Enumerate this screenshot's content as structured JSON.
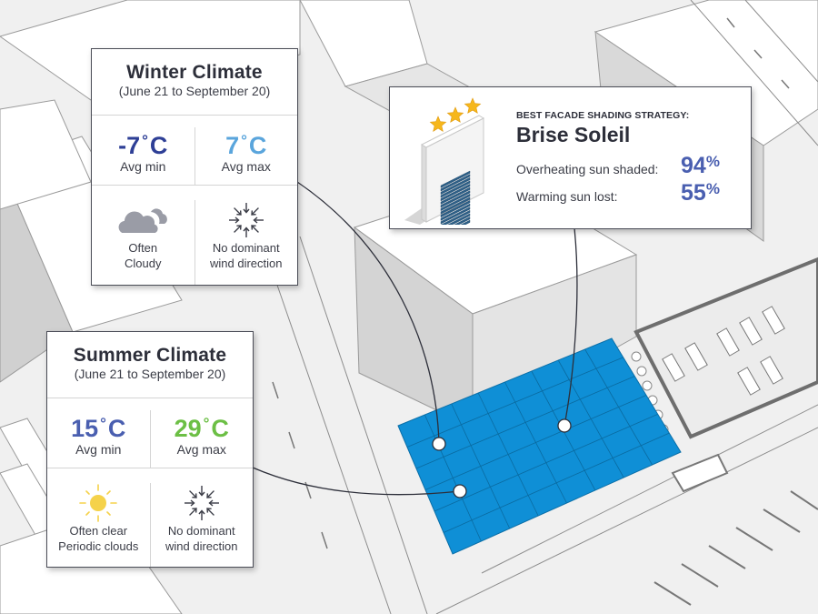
{
  "winter": {
    "title": "Winter Climate",
    "period": "(June 21 to September 20)",
    "avg_min": {
      "value": "-7",
      "unit": "C",
      "label": "Avg min",
      "color": "#2e3f96"
    },
    "avg_max": {
      "value": "7",
      "unit": "C",
      "label": "Avg max",
      "color": "#5aa5dc"
    },
    "sky": {
      "icon": "cloud-icon",
      "line1": "Often",
      "line2": "Cloudy"
    },
    "wind": {
      "icon": "wind-converging-icon",
      "line1": "No dominant",
      "line2": "wind direction"
    }
  },
  "summer": {
    "title": "Summer Climate",
    "period": "(June 21 to September 20)",
    "avg_min": {
      "value": "15",
      "unit": "C",
      "label": "Avg min",
      "color": "#4a5fb0"
    },
    "avg_max": {
      "value": "29",
      "unit": "C",
      "label": "Avg max",
      "color": "#6cbf45"
    },
    "sky": {
      "icon": "sun-icon",
      "line1": "Often clear",
      "line2": "Periodic clouds"
    },
    "wind": {
      "icon": "wind-converging-icon",
      "line1": "No dominant",
      "line2": "wind direction"
    }
  },
  "strategy": {
    "kicker": "BEST FACADE SHADING STRATEGY:",
    "name": "Brise Soleil",
    "rating_stars": 3,
    "icon": "facade-louver-icon",
    "metrics": [
      {
        "label": "Overheating sun shaded:",
        "value": "94",
        "unit": "%"
      },
      {
        "label": "Warming sun lost:",
        "value": "55",
        "unit": "%"
      }
    ],
    "accent_color": "#4a5fb0"
  },
  "colors": {
    "solar_grid": "#0f8fd6",
    "star": "#f6b71c",
    "sun": "#f5d24a",
    "cloud": "#9a9ca6",
    "louver": "#2d5f87"
  },
  "site_grid": {
    "columns": 8,
    "rows": 6
  }
}
